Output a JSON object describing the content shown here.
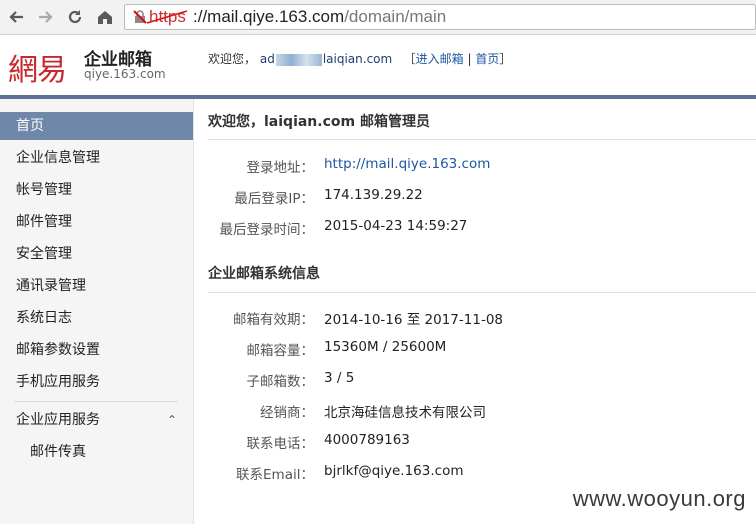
{
  "browser": {
    "url_scheme": "https",
    "url_host": "://mail.qiye.163.com",
    "url_path": "/domain/main"
  },
  "header": {
    "logo_mark": "網易",
    "logo_title": "企业邮箱",
    "logo_domain": "qiye.163.com",
    "welcome_prefix": "欢迎您，",
    "user_start": "ad",
    "user_end": "laiqian.com",
    "link_open": "［",
    "enter_mail": "进入邮箱",
    "link_sep": "|",
    "home_link": "首页",
    "link_close": "］"
  },
  "sidebar": {
    "items": [
      {
        "label": "首页"
      },
      {
        "label": "企业信息管理"
      },
      {
        "label": "帐号管理"
      },
      {
        "label": "邮件管理"
      },
      {
        "label": "安全管理"
      },
      {
        "label": "通讯录管理"
      },
      {
        "label": "系统日志"
      },
      {
        "label": "邮箱参数设置"
      },
      {
        "label": "手机应用服务"
      }
    ],
    "group": {
      "label": "企业应用服务",
      "chevron": "⌃"
    },
    "sub_items": [
      {
        "label": "邮件传真"
      }
    ]
  },
  "main": {
    "section1_title": "欢迎您，laiqian.com 邮箱管理员",
    "login_url_label": "登录地址：",
    "login_url_value": "http://mail.qiye.163.com",
    "last_ip_label": "最后登录IP：",
    "last_ip_value": "174.139.29.22",
    "last_time_label": "最后登录时间：",
    "last_time_value": "2015-04-23 14:59:27",
    "section2_title": "企业邮箱系统信息",
    "validity_label": "邮箱有效期：",
    "validity_value": "2014-10-16 至 2017-11-08",
    "capacity_label": "邮箱容量：",
    "capacity_value": "15360M / 25600M",
    "sub_count_label": "子邮箱数：",
    "sub_count_value": "3 / 5",
    "dealer_label": "经销商：",
    "dealer_value": "北京海硅信息技术有限公司",
    "phone_label": "联系电话：",
    "phone_value": "4000789163",
    "email_label": "联系Email：",
    "email_value": "bjrlkf@qiye.163.com"
  },
  "watermark": "www.wooyun.org",
  "colors": {
    "brand_red": "#c8282e",
    "active_nav": "#6f87a8",
    "link": "#1d57a3"
  }
}
